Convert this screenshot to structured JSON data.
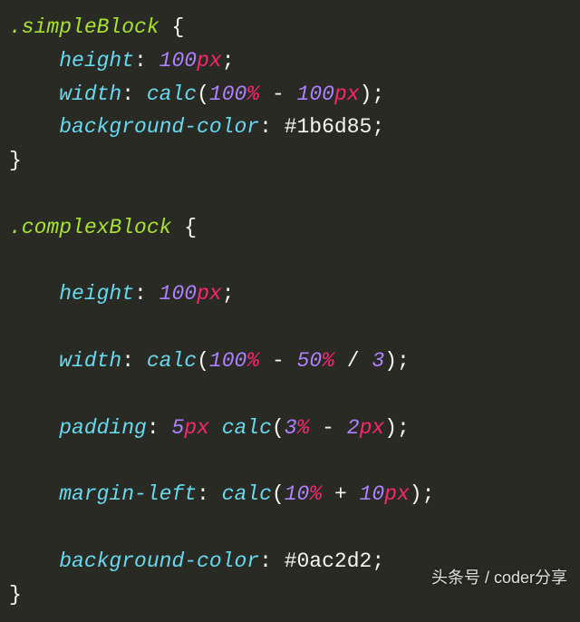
{
  "code": {
    "rule1": {
      "selector": ".simpleBlock",
      "decls": {
        "height": {
          "prop": "height",
          "num": "100",
          "unit": "px"
        },
        "width": {
          "prop": "width",
          "func": "calc",
          "a_num": "100",
          "a_unit": "%",
          "op": "-",
          "b_num": "100",
          "b_unit": "px"
        },
        "bg": {
          "prop": "background-color",
          "hex": "#1b6d85"
        }
      }
    },
    "rule2": {
      "selector": ".complexBlock",
      "decls": {
        "height": {
          "prop": "height",
          "num": "100",
          "unit": "px"
        },
        "width": {
          "prop": "width",
          "func": "calc",
          "a_num": "100",
          "a_unit": "%",
          "op1": "-",
          "b_num": "50",
          "b_unit": "%",
          "op2": "/",
          "c_num": "3"
        },
        "padding": {
          "prop": "padding",
          "v1_num": "5",
          "v1_unit": "px",
          "func": "calc",
          "a_num": "3",
          "a_unit": "%",
          "op": "-",
          "b_num": "2",
          "b_unit": "px"
        },
        "margin_left": {
          "prop": "margin-left",
          "func": "calc",
          "a_num": "10",
          "a_unit": "%",
          "op": "+",
          "b_num": "10",
          "b_unit": "px"
        },
        "bg": {
          "prop": "background-color",
          "hex": "#0ac2d2"
        }
      }
    }
  },
  "watermark": "头条号 / coder分享"
}
